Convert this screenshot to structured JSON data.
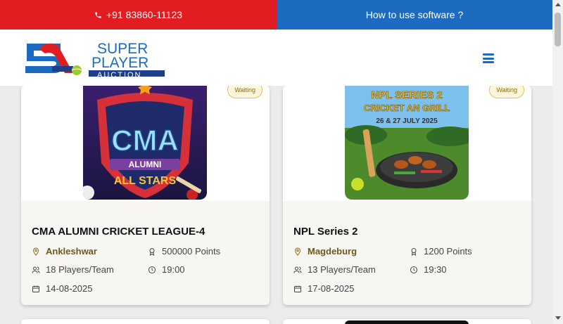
{
  "topbar": {
    "phone": "+91 83860-11123",
    "help": "How to use software ?"
  },
  "header": {
    "logo_text_line1": "SUPER",
    "logo_text_line2": "PLAYER",
    "logo_text_line3": "AUCTION"
  },
  "colors": {
    "red": "#e11d22",
    "blue": "#1d6bc0",
    "location": "#6b5a1a",
    "badge_border": "#e0c35a"
  },
  "cards": [
    {
      "badge": "Waiting",
      "image_caption_1": "CMA",
      "image_caption_2": "ALUMNI",
      "image_caption_3": "ALL STARS",
      "title": "CMA ALUMNI CRICKET LEAGUE-4",
      "location": "Ankleshwar",
      "points": "500000 Points",
      "players": "18 Players/Team",
      "time": "19:00",
      "date": "14-08-2025"
    },
    {
      "badge": "Waiting",
      "image_caption_1": "NPL SERIES 2",
      "image_caption_2": "CRICKET AN GRILL",
      "image_caption_3": "26 & 27 JULY 2025",
      "title": "NPL Series 2",
      "location": "Magdeburg",
      "points": "1200 Points",
      "players": "13 Players/Team",
      "time": "19:30",
      "date": "17-08-2025"
    }
  ]
}
